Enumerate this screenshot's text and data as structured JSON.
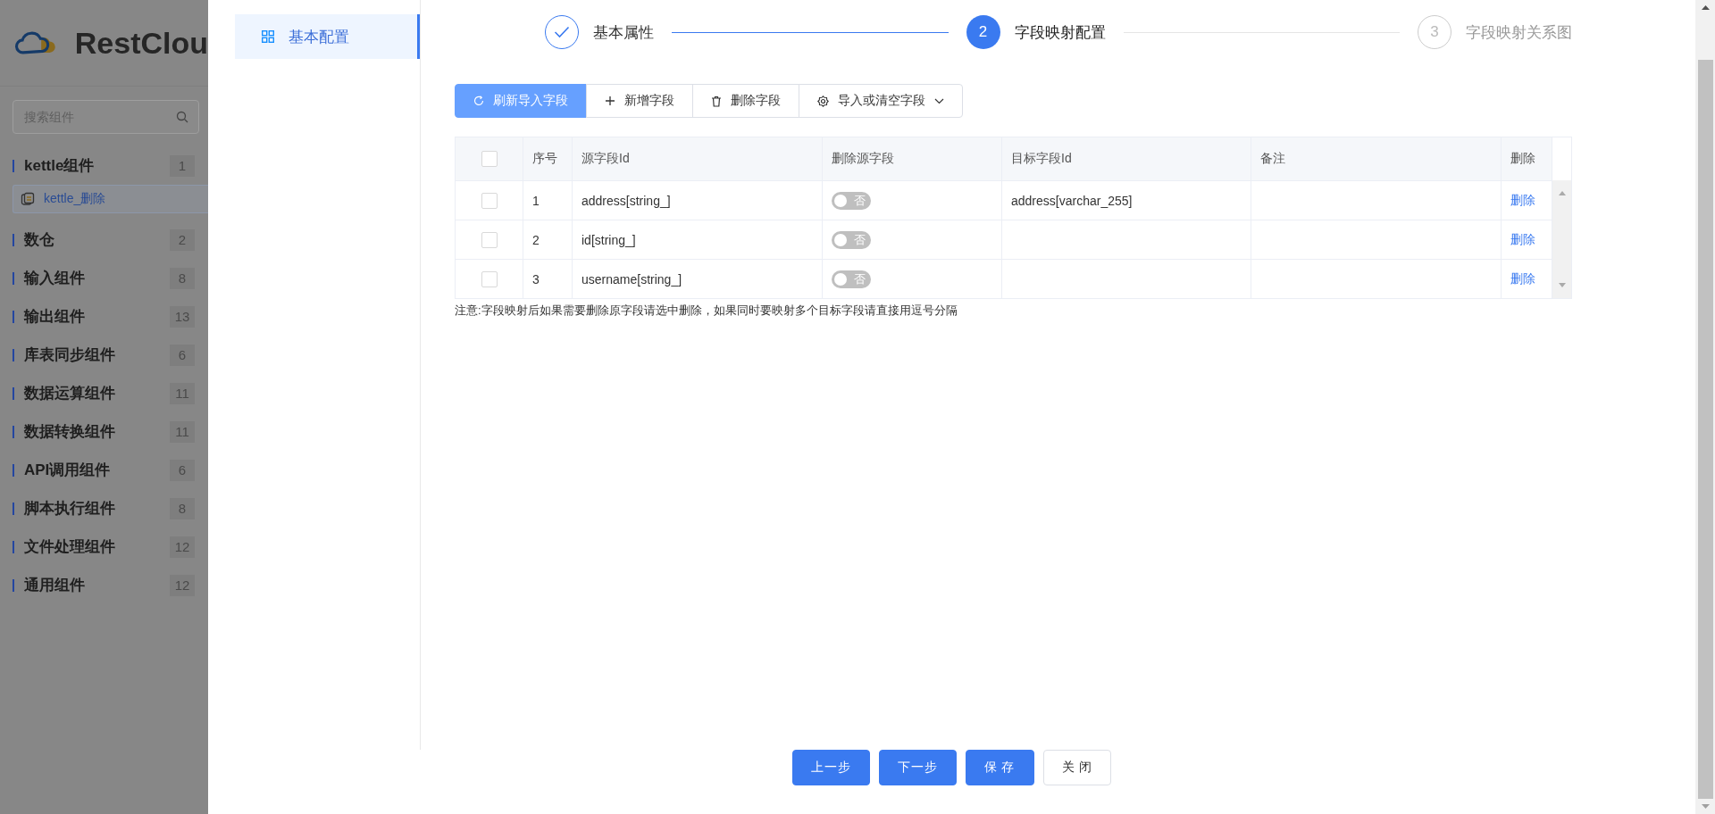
{
  "background": {
    "logo_text": "RestClou",
    "search": {
      "placeholder": "搜索组件"
    },
    "categories": [
      {
        "label": "kettle组件",
        "count": "1",
        "children": [
          {
            "label": "kettle_删除"
          }
        ]
      },
      {
        "label": "数仓",
        "count": "2"
      },
      {
        "label": "输入组件",
        "count": "8"
      },
      {
        "label": "输出组件",
        "count": "13"
      },
      {
        "label": "库表同步组件",
        "count": "6"
      },
      {
        "label": "数据运算组件",
        "count": "11"
      },
      {
        "label": "数据转换组件",
        "count": "11"
      },
      {
        "label": "API调用组件",
        "count": "6"
      },
      {
        "label": "脚本执行组件",
        "count": "8"
      },
      {
        "label": "文件处理组件",
        "count": "12"
      },
      {
        "label": "通用组件",
        "count": "12"
      }
    ]
  },
  "menu": [
    {
      "label": "基本配置",
      "selected": true
    }
  ],
  "steps": [
    {
      "title": "基本属性",
      "completed": true,
      "selected": false
    },
    {
      "number": "2",
      "title": "字段映射配置",
      "completed": false,
      "selected": true
    },
    {
      "number": "3",
      "title": "字段映射关系图",
      "completed": false,
      "selected": false
    }
  ],
  "toolbar": [
    {
      "label": "刷新导入字段",
      "kind": "refresh",
      "primary": true
    },
    {
      "label": "新增字段",
      "kind": "add",
      "primary": false
    },
    {
      "label": "删除字段",
      "kind": "delete",
      "primary": false
    },
    {
      "label": "导入或清空字段",
      "kind": "import",
      "primary": false
    }
  ],
  "table": {
    "columns": [
      "序号",
      "源字段Id",
      "删除源字段",
      "目标字段Id",
      "备注",
      "删除"
    ],
    "header_checked": false,
    "rows": [
      {
        "checked": false,
        "index": "1",
        "source": "address[string_]",
        "delete_source": {
          "on": false,
          "label": "否"
        },
        "target": "address[varchar_255]",
        "action": "删除"
      },
      {
        "checked": false,
        "index": "2",
        "source": "id[string_]",
        "delete_source": {
          "on": false,
          "label": "否"
        },
        "action": "删除"
      },
      {
        "checked": false,
        "index": "3",
        "source": "username[string_]",
        "delete_source": {
          "on": false,
          "label": "否"
        },
        "action": "删除"
      }
    ]
  },
  "note": "注意:字段映射后如果需要删除原字段请选中删除，如果同时要映射多个目标字段请直接用逗号分隔",
  "footer_buttons": [
    {
      "label": "上一步",
      "primary": true
    },
    {
      "label": "下一步",
      "primary": true
    },
    {
      "label": "保 存",
      "primary": true
    },
    {
      "label": "关 闭",
      "primary": false
    }
  ]
}
